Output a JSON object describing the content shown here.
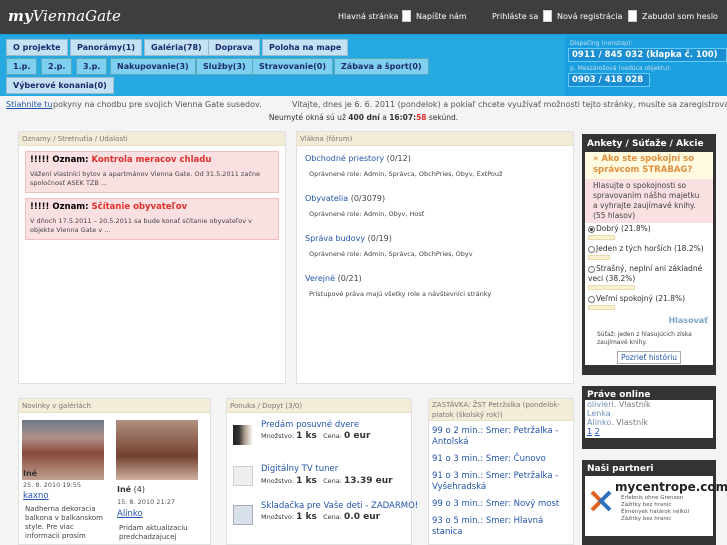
{
  "header": {
    "logo_my": "my",
    "logo_rest": "ViennaGate",
    "home": "Hlavná stránka",
    "write_us": "Napíšte nám",
    "login": "Prihláste sa",
    "register": "Nová registrácia",
    "forgot": "Zabudol som heslo"
  },
  "nav": {
    "row1": [
      "O projekte",
      "Panorámy(1)",
      "Galéria(78)",
      "Doprava",
      "Poloha na mape"
    ],
    "row2": [
      "1.p.",
      "2.p.",
      "3.p.",
      "Nakupovanie(3)",
      "Služby(3)",
      "Stravovanie(0)",
      "Zábava a šport(0)"
    ],
    "row3": [
      "Výberové konania(0)"
    ]
  },
  "dispatch": {
    "label1": "Dispečing (nonstop):",
    "phone1": "0911 / 845 032 (klapka č. 100)",
    "label2": "p. Meszárošová (vedúca objektu):",
    "phone2": "0903 / 418 028"
  },
  "infobar": {
    "download": "Stiahnite tu",
    "rest": " pokyny na chodbu pre svojich Vienna Gate susedov.",
    "welcome": "Vitajte, dnes je 6. 6. 2011 (pondelok) a pokiaľ chcete využívať možnosti tejto stránky, musíte sa zaregistrovať."
  },
  "countdown": {
    "pre": "Neumyté okná sú už ",
    "days": "400 dní",
    "mid": " a ",
    "h": "16",
    "colon1": ":",
    "m": "07",
    "colon2": ":",
    "s": "58",
    "post": " sekúnd."
  },
  "announcements": {
    "title": "Oznamy / Stretnutia / Udalosti",
    "items": [
      {
        "label": "!!!!! Oznam: ",
        "title": "Kontrola meracov chladu",
        "body": "Vážení vlastníci bytov a apartmánov Vienna Gate. Od 31.5.2011 začne spoločnosť ASEK TZB ..."
      },
      {
        "label": "!!!!! Oznam: ",
        "title": "Sčítanie obyvateľov",
        "body": "V dňoch 17.5.2011 – 20.5.2011 sa bude konať sčítanie obyvateľov v objekte Vienna Gate v ..."
      }
    ]
  },
  "forum": {
    "title": "Vlákna (fórum)",
    "items": [
      {
        "name": "Obchodné priestory",
        "count": " (0/12)",
        "perm": "Oprávnené role: Admin, Správca, ObchPries, Obyv, ExtPouž"
      },
      {
        "name": "Obyvatelia",
        "count": " (0/3079)",
        "perm": "Oprávnené role: Admin, Obyv, Hosť"
      },
      {
        "name": "Správa budovy",
        "count": " (0/19)",
        "perm": "Oprávnené role: Admin, Správca, ObchPries, Obyv"
      },
      {
        "name": "Verejné",
        "count": " (0/21)",
        "perm": "Prístupové práva majú všetky role a návštevníci stránky"
      }
    ]
  },
  "poll": {
    "title": "Ankety / Súťaže / Akcie",
    "question": "» Ako ste spokojní so správcom STRABAG?",
    "desc": "Hlasujte o spokojnosti so spravovaním nášho majetku a vyhrajte zaujímavé knihy.",
    "votes": "(55 hlasov)",
    "options": [
      {
        "label": "Dobrý (21.8%)",
        "pct": 21.8,
        "checked": true
      },
      {
        "label": "Jeden z tých horších (18.2%)",
        "pct": 18.2,
        "checked": false
      },
      {
        "label": "Strašný, neplní ani základné veci (38.2%)",
        "pct": 38.2,
        "checked": false
      },
      {
        "label": "Veľmi spokojný (21.8%)",
        "pct": 21.8,
        "checked": false
      }
    ],
    "vote": "Hlasovať",
    "note": "Súťaž: jeden z hlasujúcich získa zaujímavé knihy.",
    "history": "Pozrieť históriu"
  },
  "online": {
    "title": "Práve online",
    "users": [
      {
        "name": "olivieri",
        "role": ". Vlastník"
      },
      {
        "name": "Lenka",
        "role": ""
      },
      {
        "name": "Alinko",
        "role": ". Vlastník"
      }
    ],
    "pages": [
      "1",
      "2"
    ]
  },
  "partners": {
    "title": "Naši partneri",
    "logo": "mycentrope.com",
    "lines": [
      "Erlebnis ohne Grenzen",
      "Zážitky bez hraníc",
      "Élmények határok nélkül",
      "Zážitky bez hranic"
    ]
  },
  "gallery": {
    "title": "Novinky v galériách",
    "items": [
      {
        "name": "Iné",
        "count": "",
        "date": "25. 8. 2010 19:55",
        "author": "kaxno",
        "desc": "Nadherna dekoracia balkona v balkanskom style. Pre viac informacii prosim"
      },
      {
        "name": "Iné",
        "count": " (4)",
        "date": "15. 8. 2010 21:27",
        "author": "Alinko",
        "desc": "Pridam aktualizaciu predchadzajucej"
      }
    ]
  },
  "offers": {
    "title": "Ponuka / Dopyt (3/0)",
    "qty_lbl": "Množstvo:",
    "price_lbl": "Cena:",
    "items": [
      {
        "name": "Predám posuvné dvere",
        "qty": "1 ks",
        "price": "0 eur"
      },
      {
        "name": "Digitálny TV tuner",
        "qty": "1 ks",
        "price": "13.39 eur"
      },
      {
        "name": "Skladačka pre Vaše deti - ZADARMO!",
        "qty": "1 ks",
        "price": "0.0 eur"
      }
    ]
  },
  "bus": {
    "title": "ZASTÁVKA: ŽST Petržalka (pondelok-piatok (školský rok))",
    "items": [
      "99 o 2 min.: Smer: Petržalka - Antolská",
      "91 o 3 min.: Smer: Čunovo",
      "91 o 3 min.: Smer: Petržalka - Vyšehradská",
      "99 o 3 min.: Smer: Nový most",
      "93 o 5 min.: Smer: Hlavná stanica"
    ]
  },
  "colors": {
    "nav_blue": "#26a9e0",
    "header_dark": "#3e3e3e",
    "alert_red": "#e03030"
  }
}
